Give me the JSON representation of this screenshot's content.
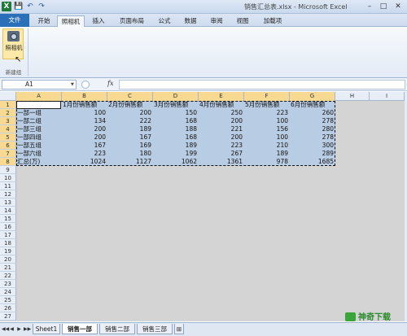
{
  "titlebar": {
    "title": "销售汇总表.xlsx - Microsoft Excel",
    "excel_icon": "X",
    "save_icon": "💾",
    "undo_icon": "↶",
    "redo_icon": "↷",
    "minimize": "–",
    "maximize": "□",
    "close": "✕"
  },
  "ribbon_tabs": [
    "文件",
    "开始",
    "照相机",
    "插入",
    "页面布局",
    "公式",
    "数据",
    "审阅",
    "视图",
    "加载项"
  ],
  "ribbon": {
    "camera_label": "照相机",
    "group_label": "新建组",
    "cursor": "↖"
  },
  "formula_bar": {
    "name_box": "A1",
    "fx": "fx",
    "formula": ""
  },
  "columns": [
    "A",
    "B",
    "C",
    "D",
    "E",
    "F",
    "G",
    "H",
    "I"
  ],
  "rows": [
    "1",
    "2",
    "3",
    "4",
    "5",
    "6",
    "7",
    "8",
    "9",
    "10",
    "11",
    "12",
    "13",
    "14",
    "15",
    "16",
    "17",
    "18",
    "19",
    "20",
    "21",
    "22",
    "23",
    "24",
    "25",
    "26",
    "27"
  ],
  "table": {
    "headers": [
      "",
      "1月份销售额",
      "2月份销售额",
      "3月份销售额",
      "4月份销售额",
      "5月份销售额",
      "6月份销售额"
    ],
    "rows": [
      [
        "一部一组",
        "100",
        "200",
        "150",
        "250",
        "223",
        "260"
      ],
      [
        "一部二组",
        "134",
        "222",
        "168",
        "200",
        "100",
        "278"
      ],
      [
        "一部三组",
        "200",
        "189",
        "188",
        "221",
        "156",
        "280"
      ],
      [
        "一部四组",
        "200",
        "167",
        "168",
        "200",
        "100",
        "278"
      ],
      [
        "一部五组",
        "167",
        "169",
        "189",
        "223",
        "210",
        "300"
      ],
      [
        "一部六组",
        "223",
        "180",
        "199",
        "267",
        "189",
        "289"
      ],
      [
        "汇总(万)",
        "1024",
        "1127",
        "1062",
        "1361",
        "978",
        "1685"
      ]
    ]
  },
  "sheet_tabs": [
    "Sheet1",
    "销售一部",
    "销售二部",
    "销售三部"
  ],
  "sheet_nav": [
    "◀◀",
    "◀",
    "▶",
    "▶▶"
  ],
  "watermark": "神奇下载"
}
